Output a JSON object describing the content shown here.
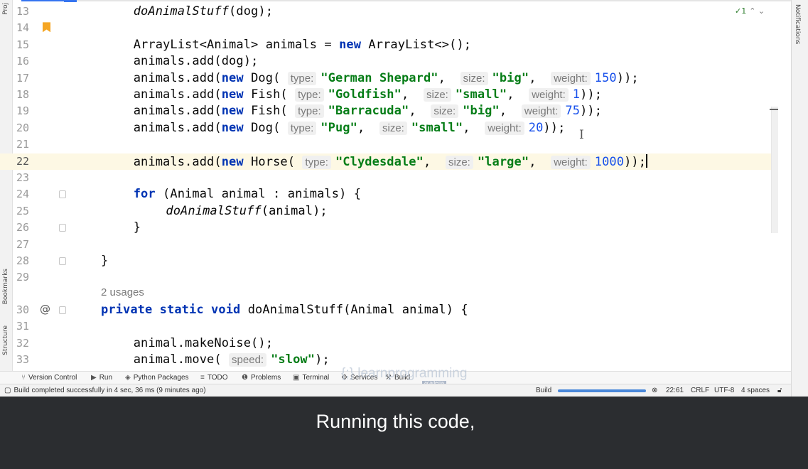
{
  "editor": {
    "lines": [
      {
        "no": "13",
        "segs": [
          {
            "t": "doAnimalStuff",
            "c": "it"
          },
          {
            "t": "(dog);"
          }
        ]
      },
      {
        "no": "14",
        "bookmark": true,
        "segs": []
      },
      {
        "no": "15",
        "segs": [
          {
            "t": "ArrayList<Animal> animals = "
          },
          {
            "t": "new",
            "c": "kw"
          },
          {
            "t": " ArrayList<>();"
          }
        ]
      },
      {
        "no": "16",
        "segs": [
          {
            "t": "animals.add(dog);"
          }
        ]
      },
      {
        "no": "17",
        "segs": [
          {
            "t": "animals.add("
          },
          {
            "t": "new",
            "c": "kw"
          },
          {
            "t": " Dog( "
          },
          {
            "t": "type:",
            "c": "hint"
          },
          {
            "t": "\"German Shepard\"",
            "c": "str"
          },
          {
            "t": ",  "
          },
          {
            "t": "size:",
            "c": "hint"
          },
          {
            "t": "\"big\"",
            "c": "str"
          },
          {
            "t": ",  "
          },
          {
            "t": "weight:",
            "c": "hint"
          },
          {
            "t": "150",
            "c": "num"
          },
          {
            "t": "));"
          }
        ]
      },
      {
        "no": "18",
        "segs": [
          {
            "t": "animals.add("
          },
          {
            "t": "new",
            "c": "kw"
          },
          {
            "t": " Fish( "
          },
          {
            "t": "type:",
            "c": "hint"
          },
          {
            "t": "\"Goldfish\"",
            "c": "str"
          },
          {
            "t": ",  "
          },
          {
            "t": "size:",
            "c": "hint"
          },
          {
            "t": "\"small\"",
            "c": "str"
          },
          {
            "t": ",  "
          },
          {
            "t": "weight:",
            "c": "hint"
          },
          {
            "t": "1",
            "c": "num"
          },
          {
            "t": "));"
          }
        ]
      },
      {
        "no": "19",
        "segs": [
          {
            "t": "animals.add("
          },
          {
            "t": "new",
            "c": "kw"
          },
          {
            "t": " Fish( "
          },
          {
            "t": "type:",
            "c": "hint"
          },
          {
            "t": "\"Barracuda\"",
            "c": "str"
          },
          {
            "t": ",  "
          },
          {
            "t": "size:",
            "c": "hint"
          },
          {
            "t": "\"big\"",
            "c": "str"
          },
          {
            "t": ",  "
          },
          {
            "t": "weight:",
            "c": "hint"
          },
          {
            "t": "75",
            "c": "num"
          },
          {
            "t": "));"
          }
        ]
      },
      {
        "no": "20",
        "segs": [
          {
            "t": "animals.add("
          },
          {
            "t": "new",
            "c": "kw"
          },
          {
            "t": " Dog( "
          },
          {
            "t": "type:",
            "c": "hint"
          },
          {
            "t": "\"Pug\"",
            "c": "str"
          },
          {
            "t": ",  "
          },
          {
            "t": "size:",
            "c": "hint"
          },
          {
            "t": "\"small\"",
            "c": "str"
          },
          {
            "t": ",  "
          },
          {
            "t": "weight:",
            "c": "hint"
          },
          {
            "t": "20",
            "c": "num"
          },
          {
            "t": "));"
          }
        ]
      },
      {
        "no": "21",
        "segs": []
      },
      {
        "no": "22",
        "current": true,
        "caret": true,
        "segs": [
          {
            "t": "animals.add("
          },
          {
            "t": "new",
            "c": "kw"
          },
          {
            "t": " Horse( "
          },
          {
            "t": "type:",
            "c": "hint"
          },
          {
            "t": "\"Clydesdale\"",
            "c": "str"
          },
          {
            "t": ",  "
          },
          {
            "t": "size:",
            "c": "hint"
          },
          {
            "t": "\"large\"",
            "c": "str"
          },
          {
            "t": ",  "
          },
          {
            "t": "weight:",
            "c": "hint"
          },
          {
            "t": "1000",
            "c": "num"
          },
          {
            "t": "));"
          }
        ]
      },
      {
        "no": "23",
        "segs": []
      },
      {
        "no": "24",
        "fold": true,
        "segs": [
          {
            "t": "for",
            "c": "kw"
          },
          {
            "t": " (Animal animal : animals) {"
          }
        ]
      },
      {
        "no": "25",
        "indent": 2,
        "segs": [
          {
            "t": "doAnimalStuff",
            "c": "it"
          },
          {
            "t": "(animal);"
          }
        ]
      },
      {
        "no": "26",
        "fold": true,
        "segs": [
          {
            "t": "}"
          }
        ]
      },
      {
        "no": "27",
        "segs": []
      },
      {
        "no": "28",
        "fold": true,
        "indent": -1,
        "segs": [
          {
            "t": "}"
          }
        ]
      },
      {
        "no": "29",
        "segs": []
      },
      {
        "no": "30",
        "at": "@",
        "fold": true,
        "usages": "2 usages",
        "indent": -1,
        "segs": [
          {
            "t": "private static void",
            "c": "kw"
          },
          {
            "t": " doAnimalStuff(Animal animal) {"
          }
        ]
      },
      {
        "no": "31",
        "segs": []
      },
      {
        "no": "32",
        "segs": [
          {
            "t": "animal.makeNoise();"
          }
        ]
      },
      {
        "no": "33",
        "segs": [
          {
            "t": "animal.move( "
          },
          {
            "t": "speed:",
            "c": "hint"
          },
          {
            "t": "\"slow\"",
            "c": "str"
          },
          {
            "t": ");"
          }
        ]
      }
    ],
    "inspection": "✓1",
    "inspection_nav": "⌃ ⌄"
  },
  "side": {
    "left_top": "Proj",
    "left_bookmarks": "Bookmarks",
    "left_structure": "Structure",
    "right": "Notifications"
  },
  "toolbar": {
    "version_control": "Version Control",
    "run": "Run",
    "python_packages": "Python Packages",
    "todo": "TODO",
    "problems": "Problems",
    "terminal": "Terminal",
    "services": "Services",
    "build": "Build"
  },
  "watermark": {
    "text": "{;} learnprogramming",
    "sub": "academy"
  },
  "status": {
    "message": "Build completed successfully in 4 sec, 36 ms (9 minutes ago)",
    "build_label": "Build",
    "progress": 1.0,
    "position": "22:61",
    "line_sep": "CRLF",
    "encoding": "UTF-8",
    "indent": "4 spaces"
  },
  "subtitle": "Running this code,"
}
